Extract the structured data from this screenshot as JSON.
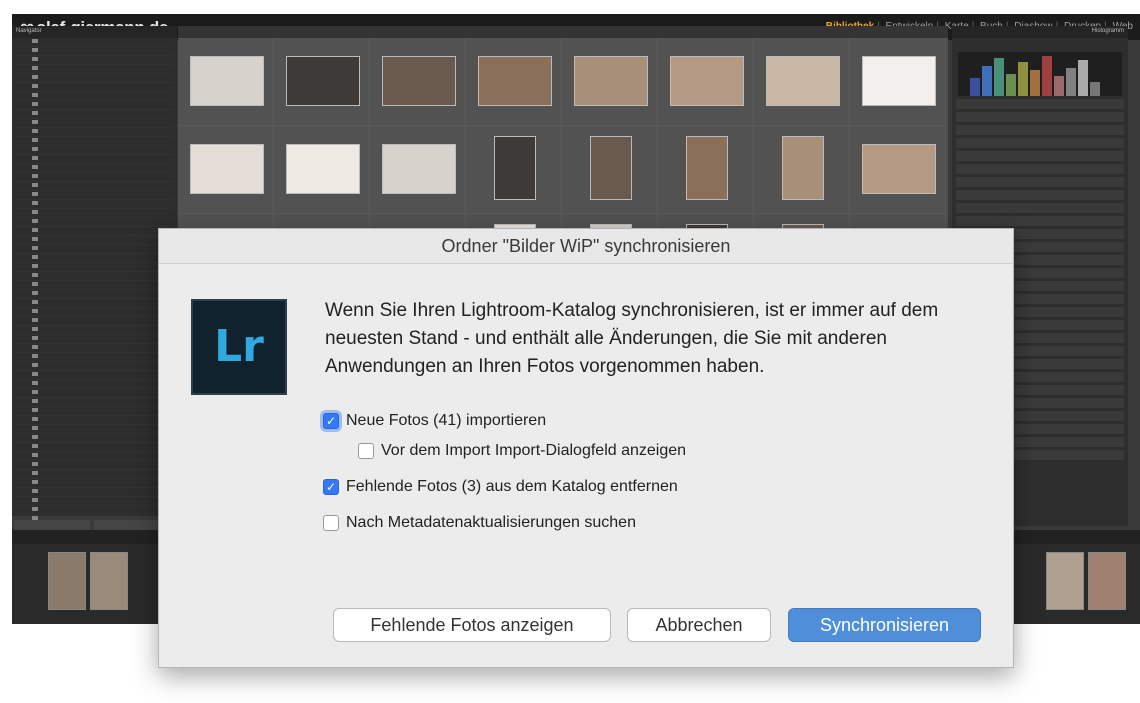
{
  "app": {
    "logo_text": "olaf-giermann.de",
    "modules": [
      "Bibliothek",
      "Entwickeln",
      "Karte",
      "Buch",
      "Diashow",
      "Drucken",
      "Web"
    ],
    "active_module": "Bibliothek"
  },
  "left_panel": {
    "header": "Navigator"
  },
  "right_panel": {
    "header": "Histogramm"
  },
  "dialog": {
    "title": "Ordner \"Bilder WiP\" synchronisieren",
    "logo": "Lr",
    "message": "Wenn Sie Ihren Lightroom-Katalog synchronisieren, ist er immer auf dem neuesten Stand - und enthält alle Änderungen, die Sie mit anderen Anwendungen an Ihren Fotos vorgenommen haben.",
    "options": {
      "import_new": {
        "label": "Neue Fotos (41) importieren",
        "checked": true
      },
      "show_import_dialog": {
        "label": "Vor dem Import Import-Dialogfeld anzeigen",
        "checked": false
      },
      "remove_missing": {
        "label": "Fehlende Fotos (3) aus dem Katalog entfernen",
        "checked": true
      },
      "scan_metadata": {
        "label": "Nach Metadatenaktualisierungen suchen",
        "checked": false
      }
    },
    "buttons": {
      "show_missing": "Fehlende Fotos anzeigen",
      "cancel": "Abbrechen",
      "synchronize": "Synchronisieren"
    },
    "colors": {
      "accent": "#3478f6",
      "primary_button": "#4f8ed8"
    }
  }
}
